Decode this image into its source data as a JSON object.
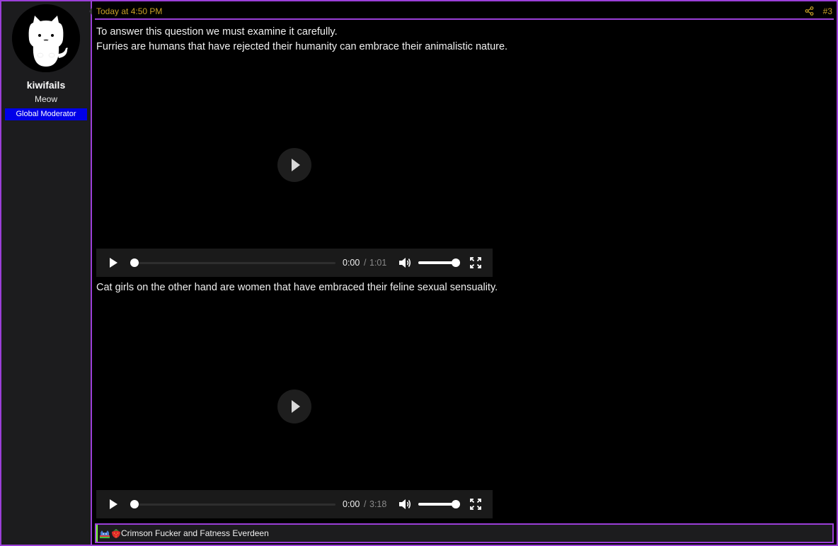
{
  "author": {
    "username": "kiwifails",
    "user_title": "Meow",
    "role_badge": "Global Moderator",
    "avatar_icon": "white-cat-avatar-icon"
  },
  "post": {
    "timestamp": "Today at 4:50 PM",
    "post_number": "#3",
    "share_icon": "share-icon",
    "paragraph_1_line_1": "To answer this question we must examine it carefully.",
    "paragraph_1_line_2": "Furries are humans that have rejected their humanity can embrace their animalistic nature.",
    "paragraph_2": "Cat girls on the other hand are women that have embraced their feline sexual sensuality."
  },
  "videos": [
    {
      "current_time": "0:00",
      "separator": "/",
      "duration": "1:01",
      "progress": 0,
      "volume": 1
    },
    {
      "current_time": "0:00",
      "separator": "/",
      "duration": "3:18",
      "progress": 0,
      "volume": 1
    }
  ],
  "reactions": {
    "icons": [
      "rainbow-cat-reaction-icon",
      "strawberry-reaction-icon"
    ],
    "text": "Crimson Fucker and Fatness Everdeen"
  },
  "colors": {
    "accent_border": "#9b3fd8",
    "timestamp": "#c9a227",
    "role_badge_bg": "#0000e8",
    "sidebar_bg": "#1c1c1e"
  }
}
